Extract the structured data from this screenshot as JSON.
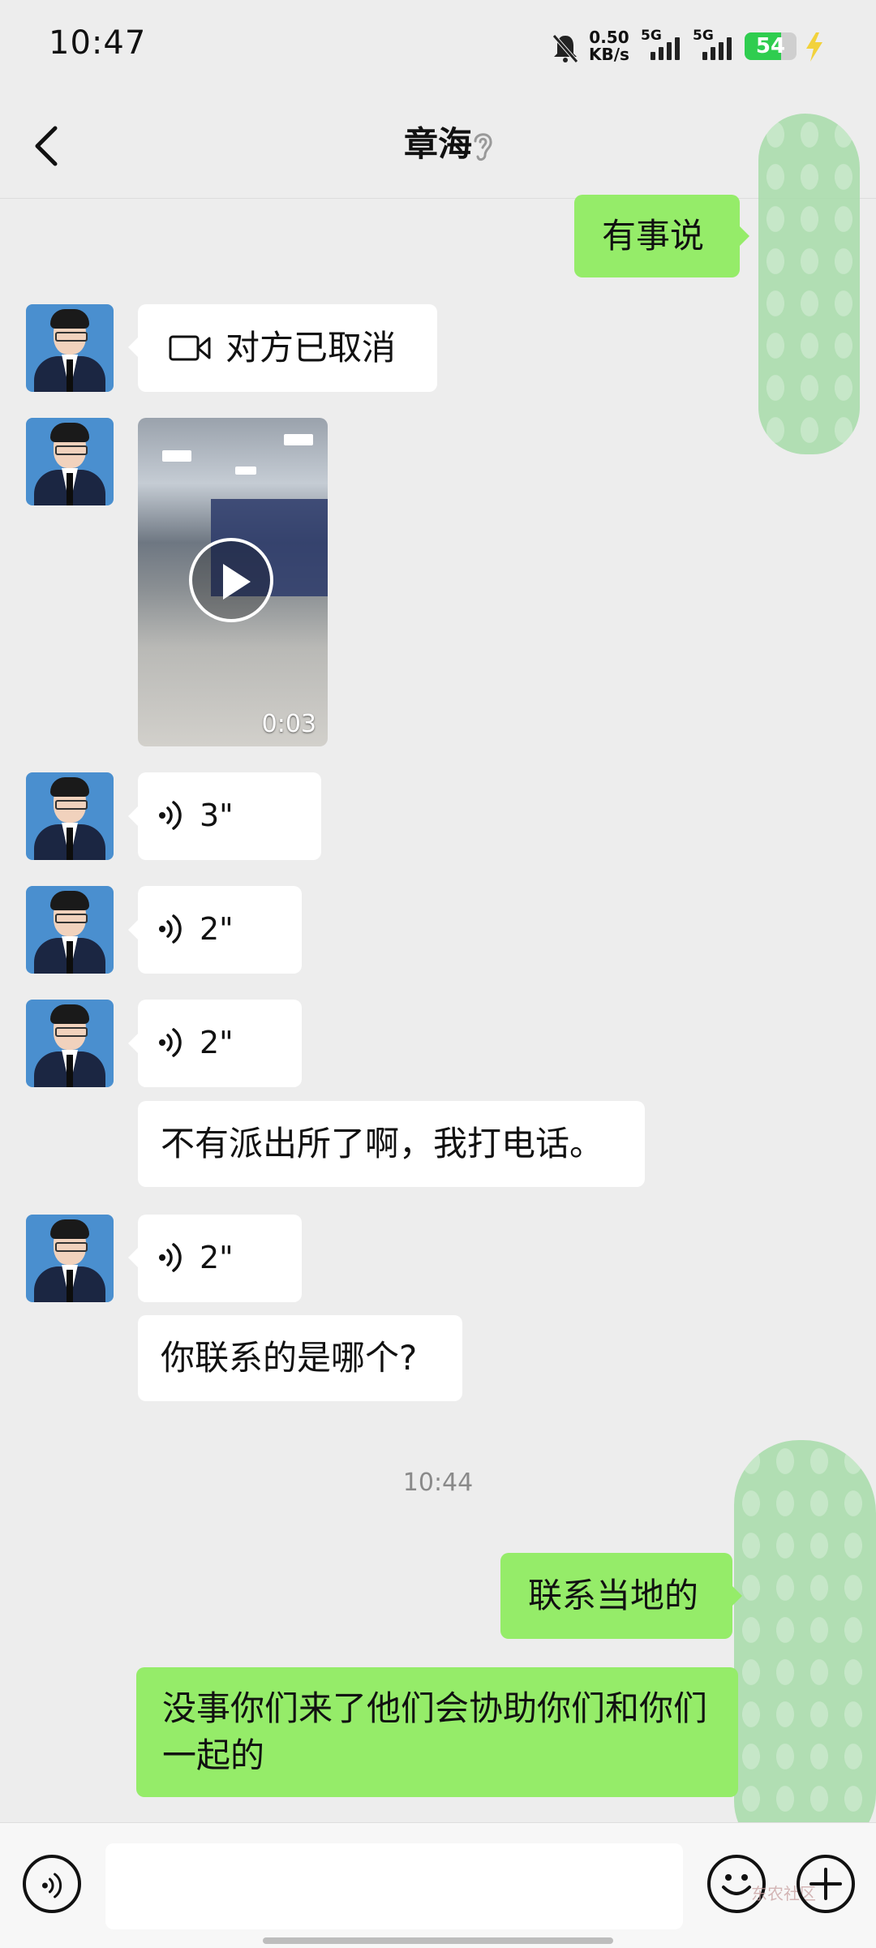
{
  "status_bar": {
    "time": "10:47",
    "net_speed_value": "0.50",
    "net_speed_unit": "KB/s",
    "signal_1_label": "5G",
    "signal_2_label": "5G",
    "battery": "54"
  },
  "header": {
    "title": "章海"
  },
  "messages": {
    "m1": "有事说",
    "m2": "对方已取消",
    "m3_video_duration": "0:03",
    "m4_voice": "3\"",
    "m5_voice": "2\"",
    "m6_voice": "2\"",
    "m7": "不有派出所了啊，我打电话。",
    "m8_voice": "2\"",
    "m9": "你联系的是哪个?",
    "time_divider": "10:44",
    "m10": "联系当地的",
    "m11": "没事你们来了他们会协助你们和你们一起的"
  },
  "watermark": "东农社区",
  "icons": [
    "back-icon",
    "ear-icon",
    "video-call-icon",
    "play-icon",
    "voice-wave-icon",
    "voice-toggle-icon",
    "emoji-icon",
    "plus-icon",
    "mute-bell-icon",
    "battery-icon",
    "signal-icon"
  ],
  "colors": {
    "background": "#ededed",
    "outgoing_bubble": "#95ec69",
    "incoming_bubble": "#ffffff",
    "battery": "#2fcd4f"
  }
}
